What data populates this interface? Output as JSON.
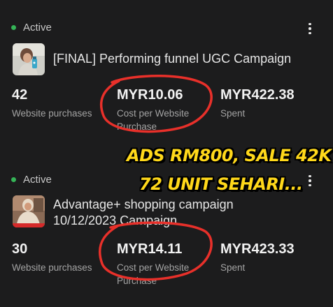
{
  "campaigns": [
    {
      "status": "Active",
      "title": "[FINAL] Performing funnel UGC Campaign",
      "metrics": [
        {
          "value": "42",
          "label": "Website purchases"
        },
        {
          "value": "MYR10.06",
          "label": "Cost per Website Purchase"
        },
        {
          "value": "MYR422.38",
          "label": "Spent"
        }
      ]
    },
    {
      "status": "Active",
      "title_line1": "Advantage+ shopping campaign",
      "title_line2": "10/12/2023 Campaign",
      "metrics": [
        {
          "value": "30",
          "label": "Website purchases"
        },
        {
          "value": "MYR14.11",
          "label": "Cost per Website Purchase"
        },
        {
          "value": "MYR423.33",
          "label": "Spent"
        }
      ]
    }
  ],
  "overlay": {
    "line1": "ADS RM800, SALE 42K",
    "line2": "72 UNIT SEHARI..."
  },
  "colors": {
    "background": "#1c1c1d",
    "status_active": "#35b457",
    "annotation_circle": "#e8302a",
    "overlay_text": "#ffd81a"
  }
}
